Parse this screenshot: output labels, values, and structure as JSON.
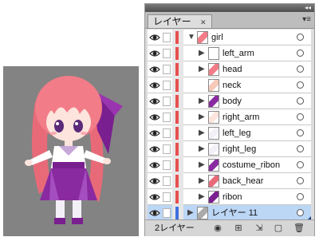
{
  "panel": {
    "tab_label": "レイヤー",
    "tab_close": "✕",
    "collapse_icon": "◂◂",
    "menu_icon": "▾≡",
    "layer_count": "2レイヤー"
  },
  "layers": [
    {
      "label": "girl",
      "level": 0,
      "arrow": "▼",
      "color": "#e8504e",
      "selected": false
    },
    {
      "label": "left_arm",
      "level": 1,
      "arrow": "▶",
      "color": "#e8504e",
      "selected": false
    },
    {
      "label": "head",
      "level": 1,
      "arrow": "▶",
      "color": "#e8504e",
      "selected": false
    },
    {
      "label": "neck",
      "level": 1,
      "arrow": "",
      "color": "#e8504e",
      "selected": false
    },
    {
      "label": "body",
      "level": 1,
      "arrow": "▶",
      "color": "#e8504e",
      "selected": false
    },
    {
      "label": "right_arm",
      "level": 1,
      "arrow": "▶",
      "color": "#e8504e",
      "selected": false
    },
    {
      "label": "left_leg",
      "level": 1,
      "arrow": "▶",
      "color": "#e8504e",
      "selected": false
    },
    {
      "label": "right_leg",
      "level": 1,
      "arrow": "▶",
      "color": "#e8504e",
      "selected": false
    },
    {
      "label": "costume_ribon",
      "level": 1,
      "arrow": "▶",
      "color": "#e8504e",
      "selected": false
    },
    {
      "label": "back_hear",
      "level": 1,
      "arrow": "▶",
      "color": "#e8504e",
      "selected": false
    },
    {
      "label": "ribon",
      "level": 1,
      "arrow": "▶",
      "color": "#e8504e",
      "selected": false
    },
    {
      "label": "レイヤー 11",
      "level": 0,
      "arrow": "▶",
      "color": "#3f6fe0",
      "selected": true
    }
  ],
  "colors": {
    "canvas_bg": "#838383",
    "selection": "#bcd6f5",
    "hair": "#f07a86",
    "costume": "#8a2aa0"
  }
}
